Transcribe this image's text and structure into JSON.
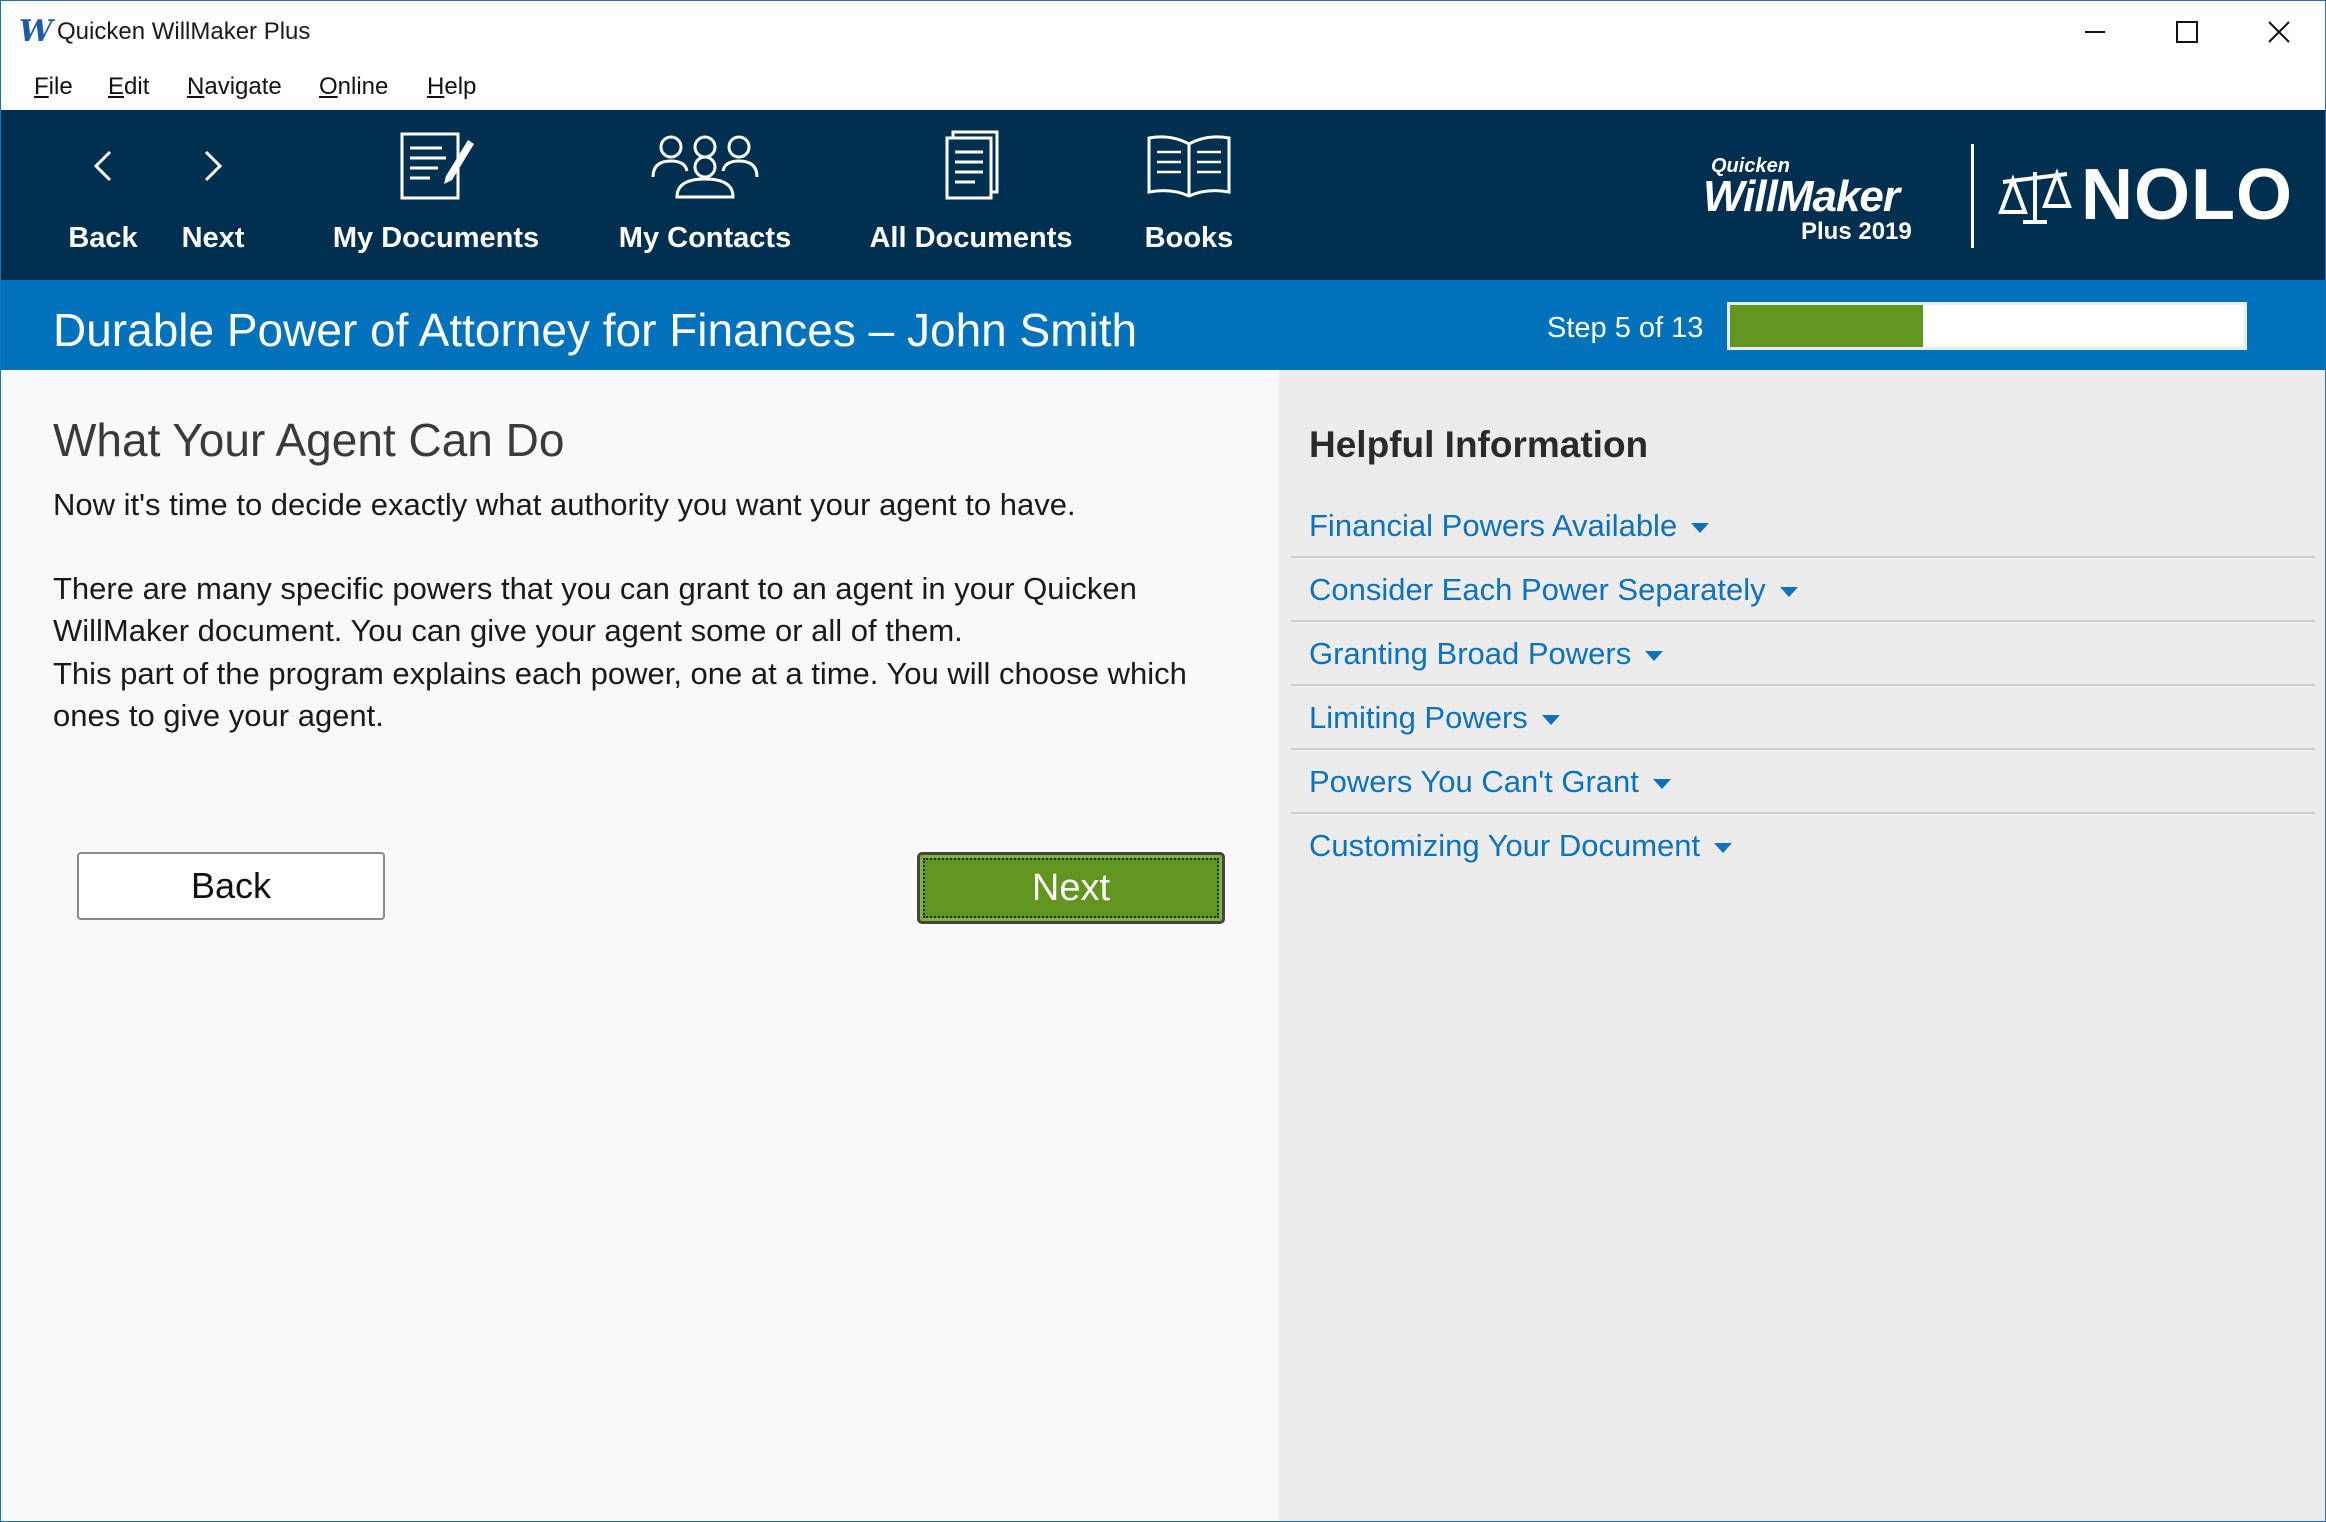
{
  "window": {
    "app_icon": "W",
    "title": "Quicken WillMaker Plus"
  },
  "menu": [
    {
      "key": "F",
      "rest": "ile"
    },
    {
      "key": "E",
      "rest": "dit"
    },
    {
      "key": "N",
      "rest": "avigate"
    },
    {
      "key": "O",
      "rest": "nline"
    },
    {
      "key": "H",
      "rest": "elp"
    }
  ],
  "toolbar": {
    "back_label": "Back",
    "next_label": "Next",
    "my_documents_label": "My Documents",
    "my_contacts_label": "My Contacts",
    "all_documents_label": "All Documents",
    "books_label": "Books"
  },
  "brand": {
    "quicken": "Quicken",
    "willmaker": "WillMaker",
    "plus_year": "Plus 2019",
    "nolo": "NOLO"
  },
  "header": {
    "doc_title": "Durable Power of Attorney for Finances – John Smith",
    "step_text": "Step 5 of 13",
    "progress_fraction": 0.375
  },
  "main": {
    "section_title": "What Your Agent Can Do",
    "paragraphs": [
      "Now it's time to decide exactly what authority you want your agent to have.",
      "There are many specific powers that you can grant to an agent in your Quicken WillMaker document. You can give your agent some or all of them.",
      "This part of the program explains each power, one at a time. You will choose which ones to give your agent."
    ],
    "back_button": "Back",
    "next_button": "Next"
  },
  "help": {
    "title": "Helpful Information",
    "items": [
      "Financial Powers Available",
      "Consider Each Power Separately",
      "Granting Broad Powers",
      "Limiting Powers",
      "Powers You Can't Grant",
      "Customizing Your Document"
    ]
  },
  "colors": {
    "toolbar_bg": "#002f4f",
    "header_bg": "#0072bc",
    "accent_green": "#62951f",
    "link_blue": "#0a72c2"
  }
}
